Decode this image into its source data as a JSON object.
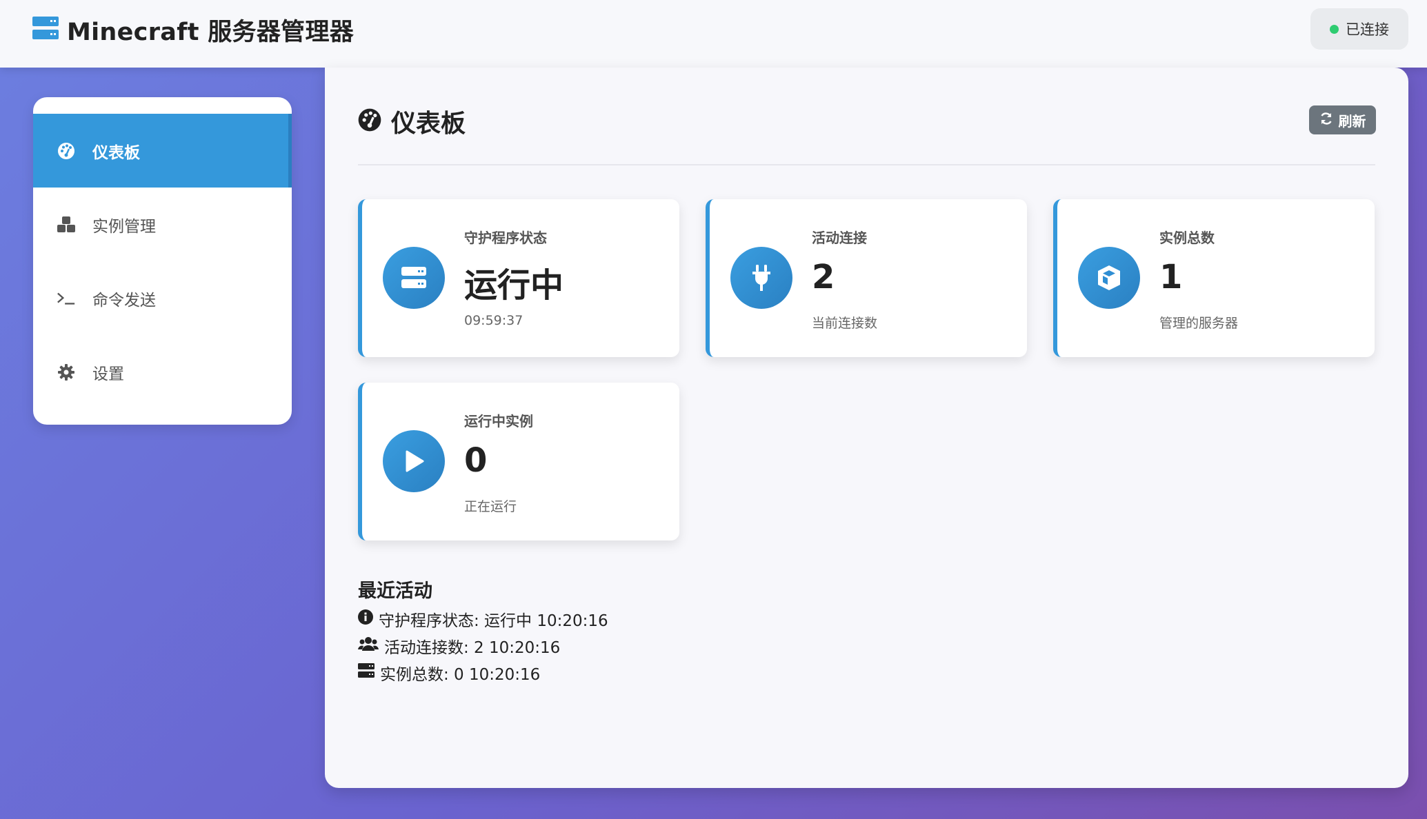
{
  "header": {
    "title": "Minecraft 服务器管理器",
    "status_label": "已连接",
    "status_color": "#2ecc71",
    "logo_icon": "server-icon"
  },
  "sidebar": {
    "items": [
      {
        "label": "仪表板",
        "icon": "dashboard-icon",
        "active": true
      },
      {
        "label": "实例管理",
        "icon": "cubes-icon",
        "active": false
      },
      {
        "label": "命令发送",
        "icon": "terminal-icon",
        "active": false
      },
      {
        "label": "设置",
        "icon": "gear-icon",
        "active": false
      }
    ]
  },
  "main": {
    "title": "仪表板",
    "refresh_label": "刷新",
    "cards": [
      {
        "label": "守护程序状态",
        "value": "运行中",
        "sub": "09:59:37",
        "icon": "server-icon"
      },
      {
        "label": "活动连接",
        "value": "2",
        "sub": "当前连接数",
        "icon": "plug-icon"
      },
      {
        "label": "实例总数",
        "value": "1",
        "sub": "管理的服务器",
        "icon": "cube-icon"
      },
      {
        "label": "运行中实例",
        "value": "0",
        "sub": "正在运行",
        "icon": "play-icon"
      }
    ],
    "recent_title": "最近活动",
    "activities": [
      {
        "text": "守护程序状态: 运行中 10:20:16",
        "icon": "info-circle-icon"
      },
      {
        "text": "活动连接数: 2 10:20:16",
        "icon": "users-icon"
      },
      {
        "text": "实例总数: 0 10:20:16",
        "icon": "server-icon"
      }
    ]
  },
  "colors": {
    "accent": "#3498db",
    "refresh_button": "#6c757d"
  }
}
